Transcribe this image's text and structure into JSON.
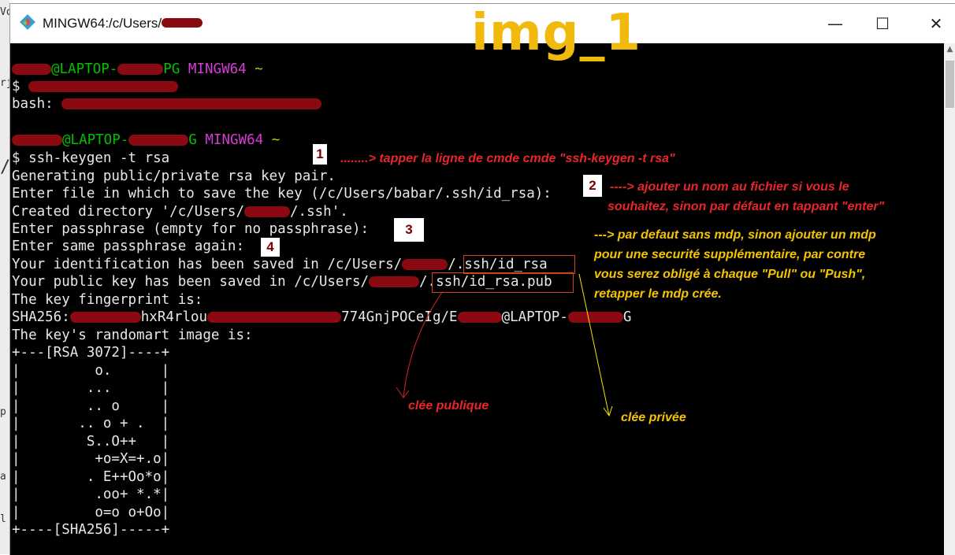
{
  "window": {
    "title_prefix": "MINGW64:/c/Users/",
    "controls": [
      "—",
      "☐",
      "✕"
    ]
  },
  "overlay_label": "img_1",
  "left_strip": [
    "Vo",
    "rj",
    "/",
    "p",
    "a",
    "l"
  ],
  "terminal": {
    "prompt1": {
      "user_suffix": "@LAPTOP-",
      "host_suffix": "PG",
      "shell": "MINGW64",
      "path": "~"
    },
    "cmd1": "$ ",
    "out1": "bash: ",
    "prompt2": {
      "user_suffix": "@LAPTOP-",
      "host_suffix": "G",
      "shell": "MINGW64",
      "path": "~"
    },
    "cmd2": "$ ssh-keygen -t rsa",
    "lines": [
      "Generating public/private rsa key pair.",
      "Enter file in which to save the key (/c/Users/babar/.ssh/id_rsa):",
      "Created directory '/c/Users/",
      "Enter passphrase (empty for no passphrase):",
      "Enter same passphrase again:",
      "Your identification has been saved in /c/Users/",
      "Your public key has been saved in /c/Users/",
      "The key fingerprint is:",
      "SHA256:"
    ],
    "dir_suffix": "/.ssh'.",
    "id_suffix": "/.ssh/id_rsa",
    "pub_suffix": "/.ssh/id_rsa.pub",
    "fp_mid": "hxR4rlou",
    "fp_mid2": "774GnjPOCeIg/E",
    "fp_host": "@LAPTOP-",
    "fp_end": "G",
    "randomart_label": "The key's randomart image is:",
    "randomart": [
      "+---[RSA 3072]----+",
      "|         o.      |",
      "|        ...      |",
      "|        .. o     |",
      "|       .. o + .  |",
      "|        S..O++   |",
      "|         +o=X=+.o|",
      "|        . E++Oo*o|",
      "|         .oo+ *.*|",
      "|         o=o o+Oo|",
      "+----[SHA256]-----+"
    ]
  },
  "annotations": {
    "n1": "1",
    "n2": "2",
    "n3": "3",
    "n4": "4",
    "a1": "........> tapper la ligne de cmde cmde \"ssh-keygen -t rsa\"",
    "a2_l1": "----> ajouter un nom au fichier si vous le",
    "a2_l2": "souhaitez, sinon par défaut en tappant \"enter\"",
    "a3_l1": "---> par defaut sans mdp, sinon ajouter un mdp",
    "a3_l2": "pour une securité supplémentaire, par contre",
    "a3_l3": "vous serez obligé à chaque \"Pull\" ou \"Push\",",
    "a3_l4": "retapper le mdp crée.",
    "public_key": "clée publique",
    "private_key": "clée privée"
  },
  "colors": {
    "prompt_user": "#00c000",
    "prompt_shell": "#d63bd6",
    "prompt_path": "#c8c800",
    "annotation_red": "#e8262a",
    "annotation_yellow": "#f5c400",
    "redaction": "#8b0a12",
    "overlay_label": "#f0b90b"
  }
}
